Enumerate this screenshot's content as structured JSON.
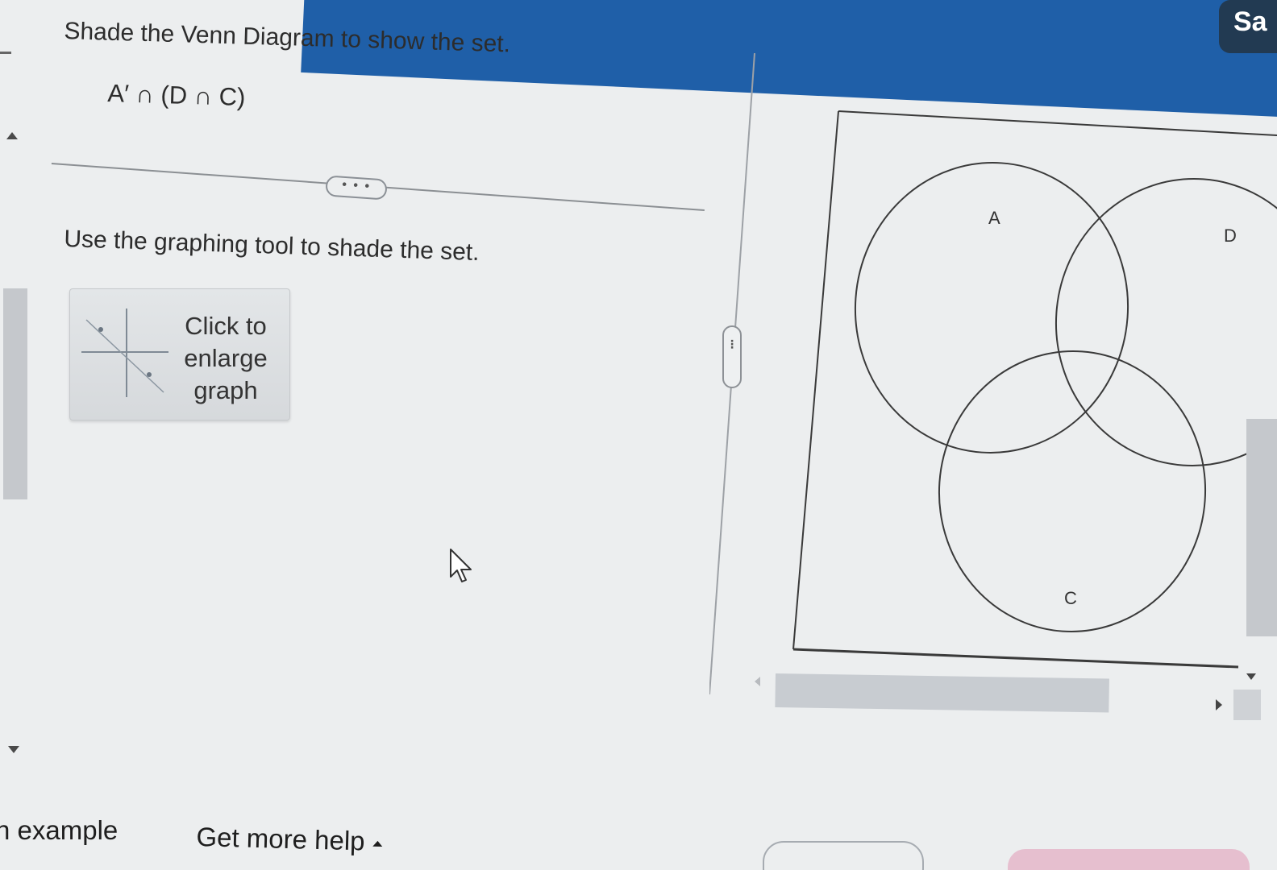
{
  "header": {
    "save_label": "Sa",
    "accent_color": "#1f5fa8",
    "save_button_color": "#223a52"
  },
  "question": {
    "instruction": "Shade the Venn Diagram to show the set.",
    "set_expression": "A′ ∩ (D ∩ C)",
    "more_label": "• • •"
  },
  "answer": {
    "instruction": "Use the graphing tool to shade the set.",
    "enlarge_lines": [
      "Click to",
      "enlarge",
      "graph"
    ],
    "thumbnail_icon": "graph-thumbnail-icon"
  },
  "venn": {
    "sets": [
      {
        "label": "A"
      },
      {
        "label": "D"
      },
      {
        "label": "C"
      }
    ]
  },
  "splitter": {
    "handle_label": "⋮"
  },
  "footer": {
    "example_label": "n example",
    "help_label": "Get more help"
  }
}
